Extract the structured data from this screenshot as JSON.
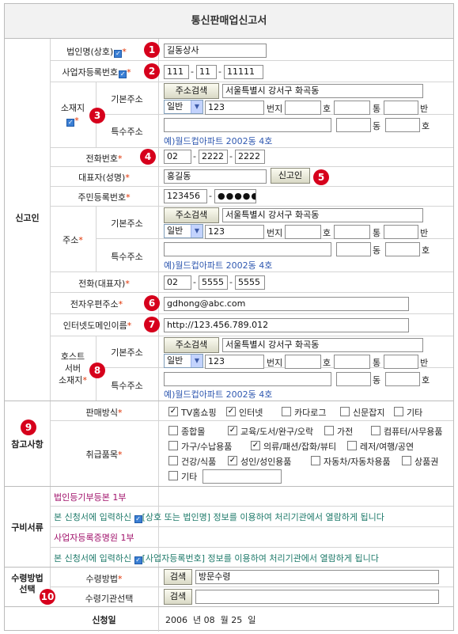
{
  "title": "통신판매업신고서",
  "sections": {
    "reporter": "신고인",
    "reference": "참고사항",
    "documents": "구비서류",
    "receipt_line1": "수령방법",
    "receipt_line2": "선택",
    "date_label": "신청일"
  },
  "badges": [
    "1",
    "2",
    "3",
    "4",
    "5",
    "6",
    "7",
    "8",
    "9",
    "10"
  ],
  "labels": {
    "corp_name": "법인명(상호)",
    "biz_no": "사업자등록번호",
    "location": "소재지",
    "basic_addr": "기본주소",
    "special_addr": "특수주소",
    "phone": "전화번호",
    "rep": "대표자(성명)",
    "rrn": "주민등록번호",
    "address": "주소",
    "rep_phone": "전화(대표자)",
    "email": "전자우편주소",
    "domain": "인터넷도메인이름",
    "host_line1": "호스트",
    "host_line2": "서버",
    "host_line3": "소재지",
    "sales_method": "판매방식",
    "items": "취급품목",
    "receipt_method": "수령방법",
    "receipt_agency": "수령기관선택",
    "req": "*"
  },
  "values": {
    "corp_name": "길동상사",
    "biz_no": [
      "111",
      "11",
      "11111"
    ],
    "addr": "서울특별시 강서구 화곡동",
    "addr_type": "일반",
    "addr_no": "123",
    "phone": [
      "02",
      "2222",
      "2222"
    ],
    "rep": "홍길동",
    "rrn_front": "123456",
    "rrn_mask": "●●●●●",
    "rep_phone": [
      "02",
      "5555",
      "5555"
    ],
    "email": "gdhong@abc.com",
    "domain": "http://123.456.789.012",
    "receipt_method": "방문수령",
    "receipt_agency": ""
  },
  "units": {
    "bunji": "번지",
    "ho": "호",
    "tong": "통",
    "ban": "반",
    "dong": "동",
    "dash": "-"
  },
  "example_text": "예)월드컵아파트 2002동 4호",
  "buttons": {
    "addr_search": "주소검색",
    "verify": "신고인",
    "search": "검색"
  },
  "sales_methods": [
    {
      "label": "TV홈쇼핑",
      "checked": true
    },
    {
      "label": "인터넷",
      "checked": true
    },
    {
      "label": "카다로그",
      "checked": false
    },
    {
      "label": "신문잡지",
      "checked": false
    },
    {
      "label": "기타",
      "checked": false
    }
  ],
  "items": [
    {
      "label": "종합몰",
      "checked": false
    },
    {
      "label": "교육/도서/완구/오락",
      "checked": true
    },
    {
      "label": "가전",
      "checked": false
    },
    {
      "label": "컴퓨터/사무용품",
      "checked": false
    },
    {
      "label": "가구/수납용품",
      "checked": false
    },
    {
      "label": "의류/패션/잡화/뷰티",
      "checked": true
    },
    {
      "label": "레저/여행/공연",
      "checked": false
    },
    {
      "label": "건강/식품",
      "checked": false
    },
    {
      "label": "성인/성인용품",
      "checked": true
    },
    {
      "label": "자동차/자동차용품",
      "checked": false
    },
    {
      "label": "상품권",
      "checked": false
    },
    {
      "label": "기타",
      "checked": false
    }
  ],
  "documents": {
    "doc1_title": "법인등기부등본 1부",
    "doc1_note_a": "본 신청서에 입력하신 ",
    "doc1_note_b": "[상호 또는 법인명] 정보를 이용하여 처리기관에서 열람하게 됩니다",
    "doc2_title": "사업자등록증명원 1부",
    "doc2_note_a": "본 신청서에 입력하신 ",
    "doc2_note_b": "[사업자등록번호] 정보를 이용하여 처리기관에서 열람하게 됩니다"
  },
  "date": {
    "year": "2006",
    "year_unit": "년",
    "month": "08",
    "month_unit": "월",
    "day": "25",
    "day_unit": "일"
  },
  "colors": {
    "required": "#e03000",
    "badge": "#d6001c",
    "example": "#2f58b0",
    "doc_title": "#a0106a",
    "doc_note": "#1e7a6a"
  }
}
